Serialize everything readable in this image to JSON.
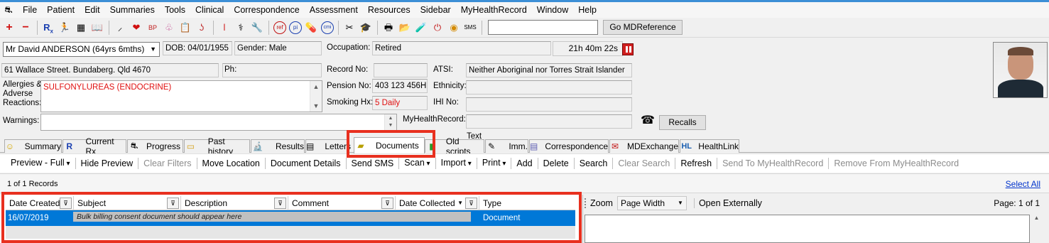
{
  "menu": [
    "File",
    "Patient",
    "Edit",
    "Summaries",
    "Tools",
    "Clinical",
    "Correspondence",
    "Assessment",
    "Resources",
    "Sidebar",
    "MyHealthRecord",
    "Window",
    "Help"
  ],
  "toolbar": {
    "search_value": "",
    "go_label": "Go MDReference",
    "icons": [
      "add-icon",
      "remove-icon",
      "prescription-icon",
      "runner-icon",
      "calculator-icon",
      "book-icon",
      "tweezers-icon",
      "heart-icon",
      "bp-icon",
      "lungs-icon",
      "clipboard-icon",
      "ear-icon",
      "thermometer-icon",
      "stethoscope-icon",
      "wrench-icon",
      "ref-icon",
      "pi-icon",
      "pill-icon",
      "cmi-icon",
      "scissors-icon",
      "graduate-icon",
      "print-icon",
      "folder-icon",
      "bottle-icon",
      "stop-icon",
      "coin-icon",
      "sms-icon"
    ]
  },
  "patient": {
    "name": "Mr David ANDERSON (64yrs 6mths)",
    "dob_label": "DOB: 04/01/1955",
    "gender_label": "Gender: Male",
    "occupation_label": "Occupation:",
    "occupation_value": "Retired",
    "timer": "21h 40m 22s",
    "address": "61 Wallace Street. Bundaberg. Qld  4670",
    "ph_label": "Ph:",
    "ph_value": "",
    "record_label": "Record No:",
    "record_value": "",
    "atsi_label": "ATSI:",
    "atsi_value": "Neither Aboriginal nor Torres Strait Islander",
    "allergies_label": "Allergies & Adverse Reactions:",
    "allergies_value": "SULFONYLUREAS (ENDOCRINE)",
    "pension_label": "Pension No:",
    "pension_value": "403 123 456H",
    "ethnicity_label": "Ethnicity:",
    "ethnicity_value": "",
    "smoking_label": "Smoking Hx:",
    "smoking_value": "5 Daily",
    "ihi_label": "IHI No:",
    "ihi_value": "",
    "warnings_label": "Warnings:",
    "warnings_value": "",
    "mhr_label": "MyHealthRecord:",
    "mhr_value": "",
    "recalls_label": "Recalls"
  },
  "tabs": [
    {
      "label": "Summary",
      "icon": "smiley-icon"
    },
    {
      "label": "Current Rx",
      "icon": "rx-icon"
    },
    {
      "label": "Progress",
      "icon": "progress-icon"
    },
    {
      "label": "Past history",
      "icon": "folder-icon"
    },
    {
      "label": "Results",
      "icon": "microscope-icon"
    },
    {
      "label": "Letters",
      "icon": "letter-icon"
    },
    {
      "label": "Documents",
      "icon": "documents-icon"
    },
    {
      "label": "Text",
      "icon": "text-icon"
    },
    {
      "label": "Old scripts",
      "icon": ""
    },
    {
      "label": "Imm.",
      "icon": "syringe-icon"
    },
    {
      "label": "Correspondence",
      "icon": "correspondence-icon"
    },
    {
      "label": "MDExchange",
      "icon": "mdexchange-icon"
    },
    {
      "label": "HealthLink",
      "icon": "healthlink-icon"
    }
  ],
  "doc_toolbar": [
    {
      "label": "Preview - Full",
      "dropdown": true,
      "enabled": true
    },
    {
      "label": "Hide Preview",
      "dropdown": false,
      "enabled": true
    },
    {
      "label": "Clear Filters",
      "dropdown": false,
      "enabled": false
    },
    {
      "label": "Move Location",
      "dropdown": false,
      "enabled": true
    },
    {
      "label": "Document Details",
      "dropdown": false,
      "enabled": true
    },
    {
      "label": "Send SMS",
      "dropdown": false,
      "enabled": true
    },
    {
      "label": "Scan",
      "dropdown": true,
      "enabled": true
    },
    {
      "label": "Import",
      "dropdown": true,
      "enabled": true
    },
    {
      "label": "Print",
      "dropdown": true,
      "enabled": true
    },
    {
      "label": "Add",
      "dropdown": false,
      "enabled": true
    },
    {
      "label": "Delete",
      "dropdown": false,
      "enabled": true
    },
    {
      "label": "Search",
      "dropdown": false,
      "enabled": true
    },
    {
      "label": "Clear Search",
      "dropdown": false,
      "enabled": false
    },
    {
      "label": "Refresh",
      "dropdown": false,
      "enabled": true
    },
    {
      "label": "Send To MyHealthRecord",
      "dropdown": false,
      "enabled": false
    },
    {
      "label": "Remove From MyHealthRecord",
      "dropdown": false,
      "enabled": false
    }
  ],
  "records": {
    "count": "1 of 1 Records",
    "select_all": "Select All"
  },
  "grid": {
    "columns": [
      "Date Created",
      "Subject",
      "Description",
      "Comment",
      "Date Collected",
      "Type"
    ],
    "rows": [
      {
        "date_created": "16/07/2019",
        "subject": "Bulk billing consent document should appear here",
        "description": "",
        "comment": "",
        "date_collected": "",
        "type": "Document"
      }
    ]
  },
  "preview": {
    "zoom_label": "Zoom",
    "zoom_value": "Page Width",
    "open_externally": "Open Externally",
    "page": "Page: 1 of 1"
  },
  "colors": {
    "accent": "#0078d7",
    "highlight": "#e8301f",
    "alert": "#e01010"
  }
}
